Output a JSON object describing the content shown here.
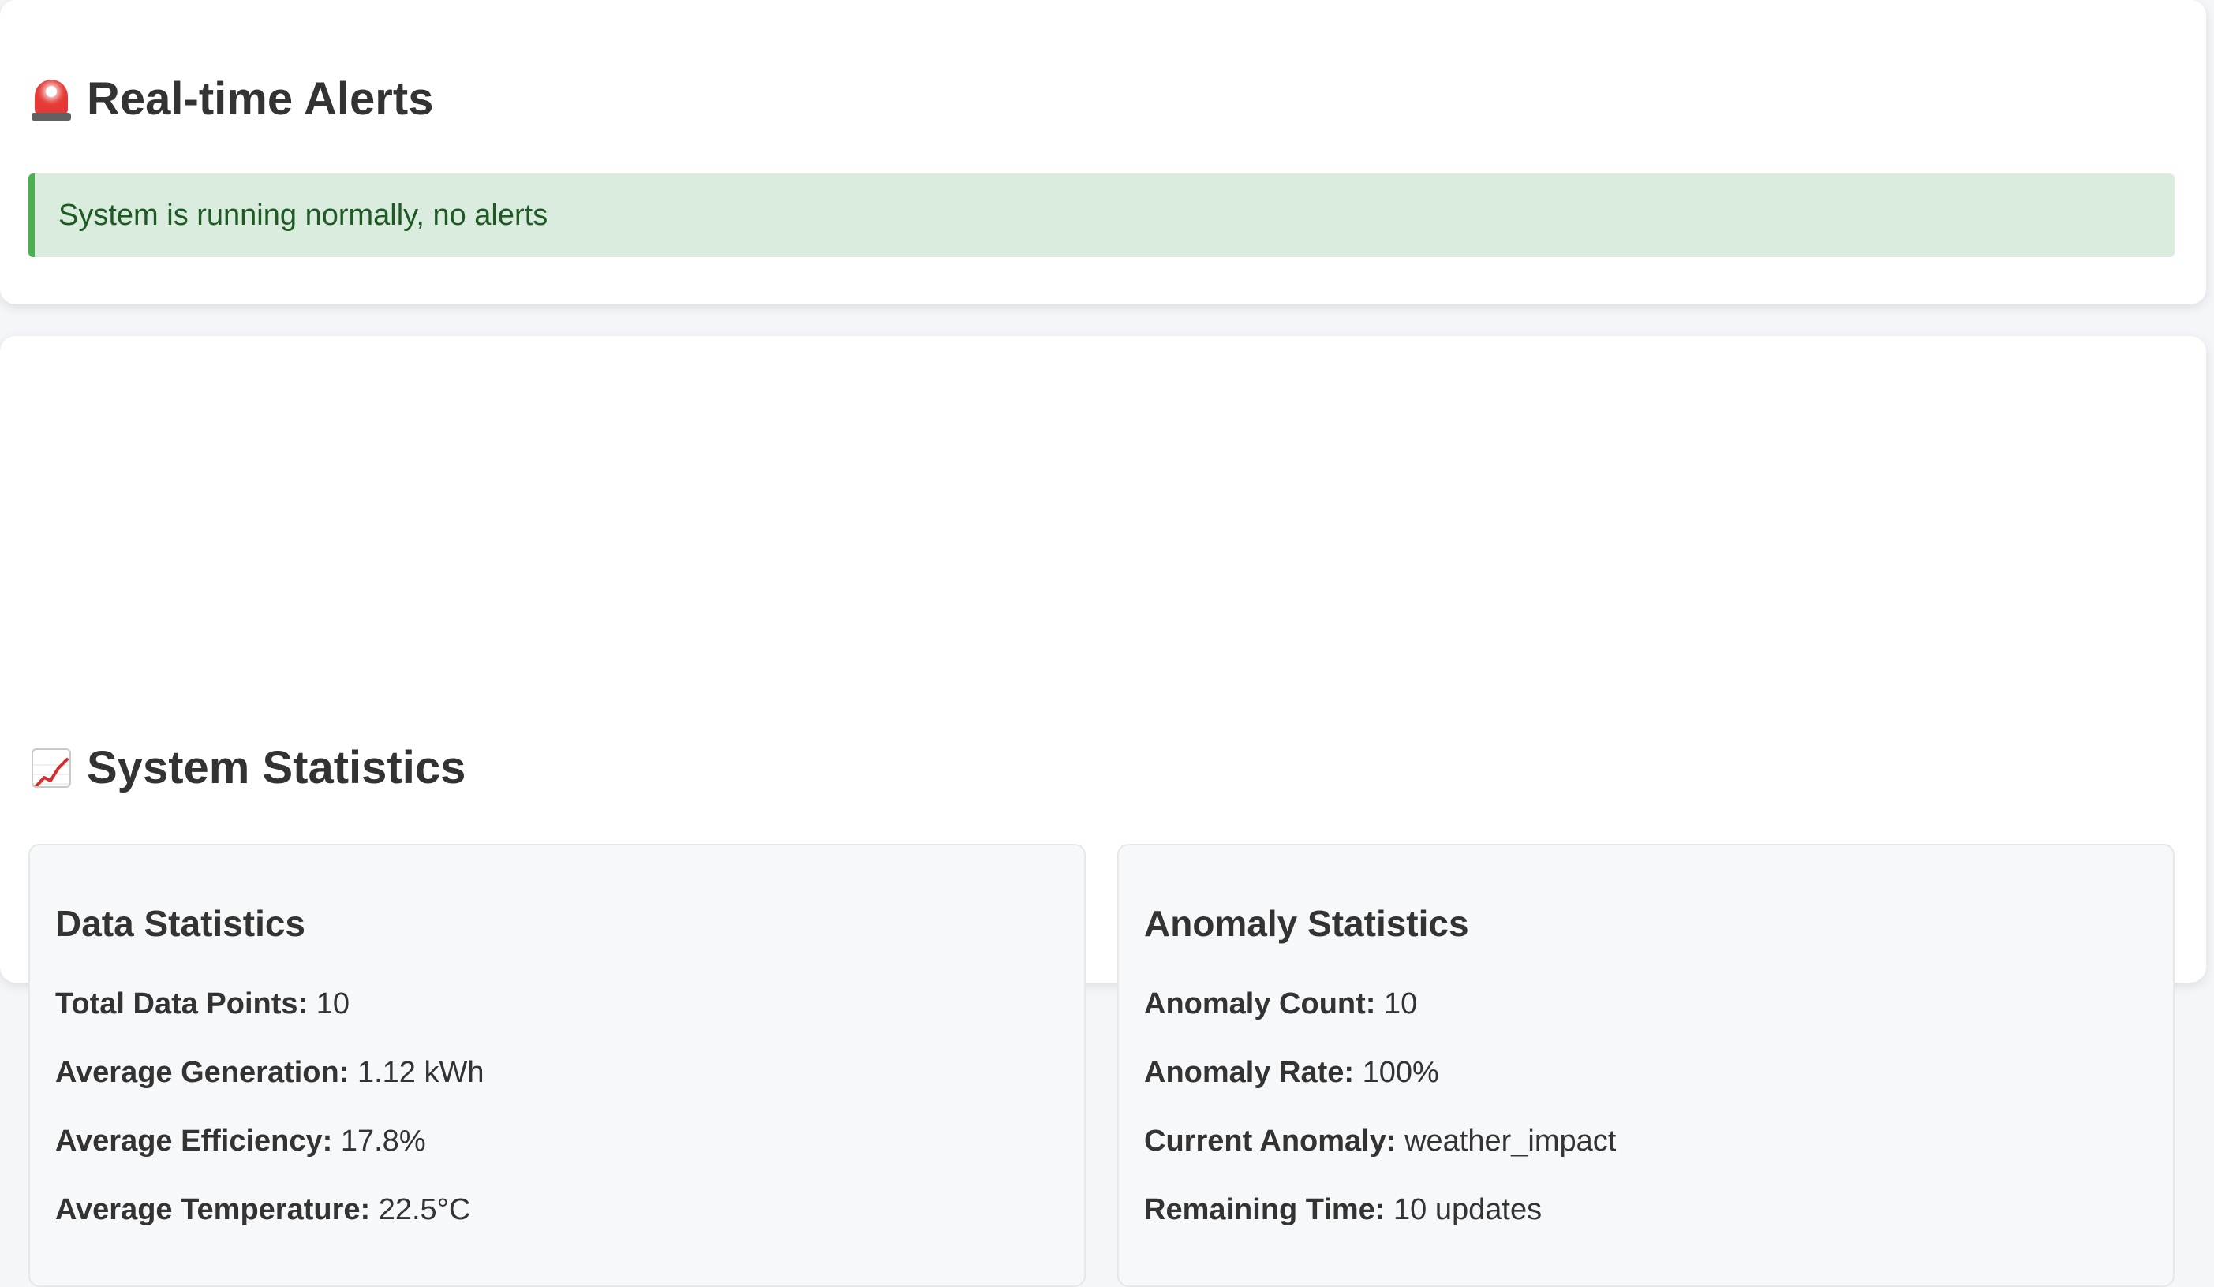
{
  "alerts": {
    "title": "Real-time Alerts",
    "icon": "siren-icon",
    "message": "System is running normally, no alerts",
    "status_color": "#4caf50"
  },
  "statistics": {
    "title": "System Statistics",
    "icon": "chart-increasing-icon",
    "data_panel": {
      "title": "Data Statistics",
      "rows": [
        {
          "label": "Total Data Points:",
          "value": "10"
        },
        {
          "label": "Average Generation:",
          "value": "1.12 kWh"
        },
        {
          "label": "Average Efficiency:",
          "value": "17.8%"
        },
        {
          "label": "Average Temperature:",
          "value": "22.5°C"
        }
      ]
    },
    "anomaly_panel": {
      "title": "Anomaly Statistics",
      "rows": [
        {
          "label": "Anomaly Count:",
          "value": "10"
        },
        {
          "label": "Anomaly Rate:",
          "value": "100%"
        },
        {
          "label": "Current Anomaly:",
          "value": "weather_impact"
        },
        {
          "label": "Remaining Time:",
          "value": "10 updates"
        }
      ]
    }
  }
}
